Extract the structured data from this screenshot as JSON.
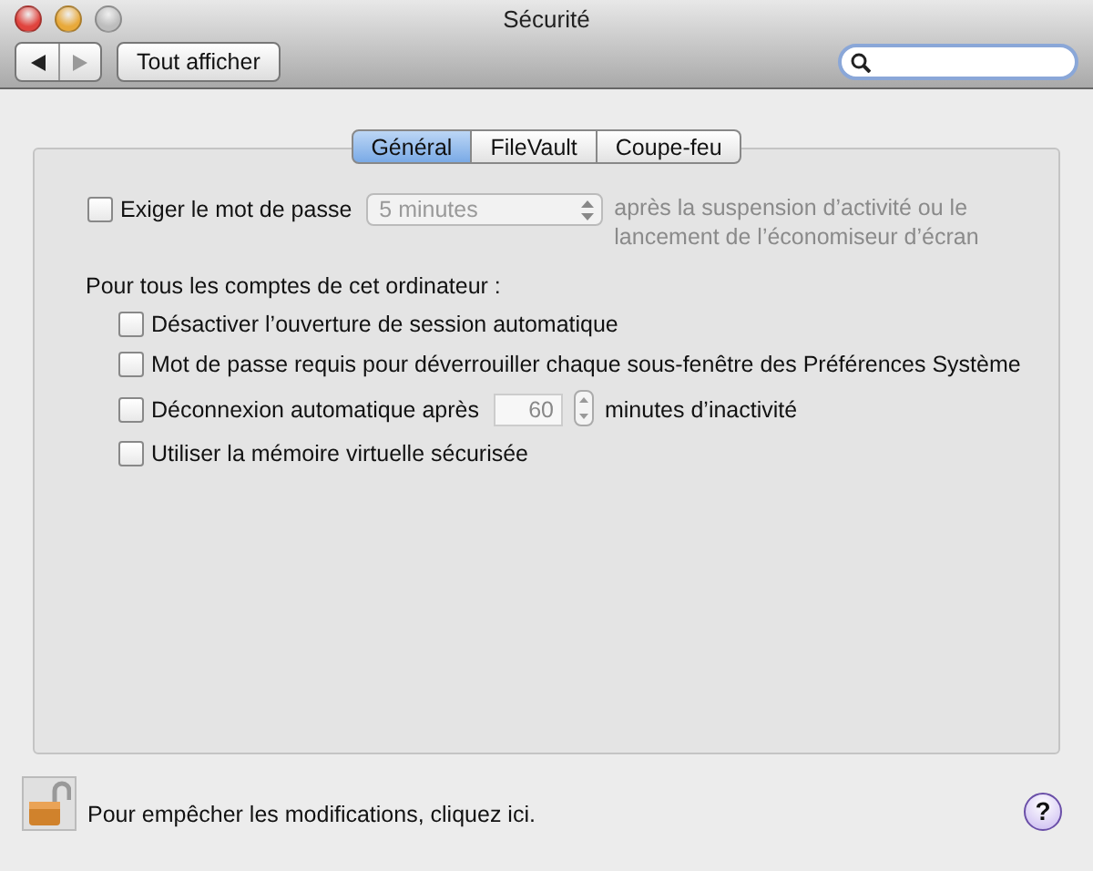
{
  "window": {
    "title": "Sécurité"
  },
  "toolbar": {
    "show_all": "Tout afficher"
  },
  "tabs": [
    {
      "label": "Général",
      "selected": true
    },
    {
      "label": "FileVault",
      "selected": false
    },
    {
      "label": "Coupe-feu",
      "selected": false
    }
  ],
  "require_password": {
    "label": "Exiger le mot de passe",
    "checked": false,
    "delay": "5 minutes",
    "disabled": true,
    "suffix": "après la suspension d’activité ou le lancement de l’économiseur d’écran"
  },
  "accounts_heading": "Pour tous les comptes de cet ordinateur :",
  "options": [
    {
      "kind": "checkbox",
      "label": "Désactiver l’ouverture de session automatique",
      "checked": false
    },
    {
      "kind": "checkbox",
      "label": "Mot de passe requis pour déverrouiller chaque sous-fenêtre des Préférences Système",
      "checked": false
    },
    {
      "kind": "timeout",
      "label": "Déconnexion automatique après",
      "checked": false,
      "value": "60",
      "suffix": "minutes d’inactivité"
    },
    {
      "kind": "checkbox",
      "label": "Utiliser la mémoire virtuelle sécurisée",
      "checked": false
    }
  ],
  "footer": {
    "locked": false,
    "text": "Pour empêcher les modifications, cliquez ici.",
    "help": "?"
  }
}
